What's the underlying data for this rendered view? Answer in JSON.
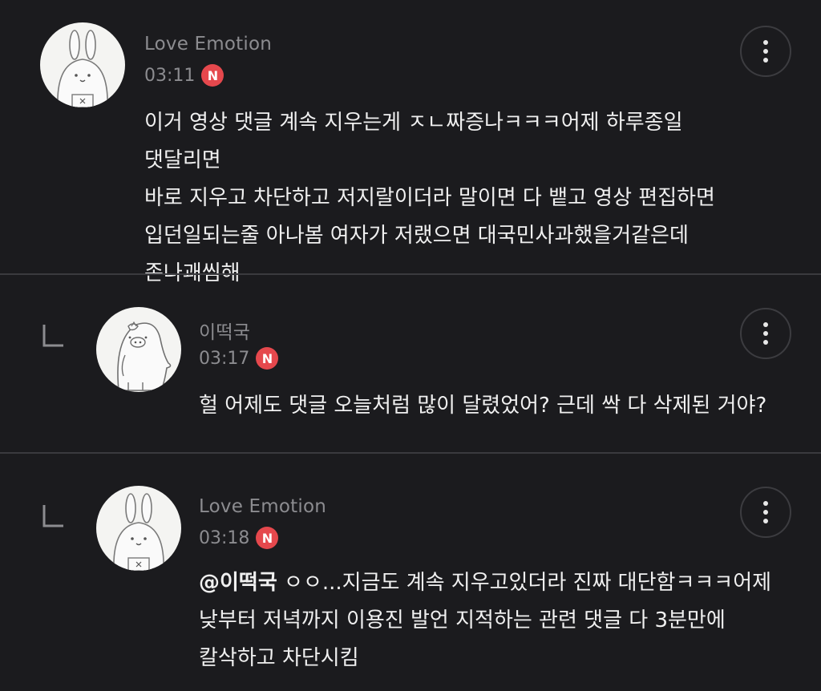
{
  "comments": [
    {
      "author": "Love Emotion",
      "time": "03:11",
      "badge": "N",
      "avatar": "rabbit-avatar",
      "text": "이거 영상 댓글 계속 지우는게 ㅈㄴ짜증나ㅋㅋㅋ어제 하루종일 댓달리면\n바로 지우고 차단하고 저지랄이더라 말이면 다 뱉고 영상 편집하면\n입던일되는줄 아나봄 여자가 저랬으면 대국민사과했을거같은데\n존나괘씸해"
    },
    {
      "author": "이떡국",
      "time": "03:17",
      "badge": "N",
      "avatar": "penguin-pig-avatar",
      "text": "헐 어제도 댓글 오늘처럼 많이 달렸었어? 근데 싹 다 삭제된 거야?"
    },
    {
      "author": "Love Emotion",
      "time": "03:18",
      "badge": "N",
      "avatar": "rabbit-avatar",
      "mention": "@이떡국",
      "text": "  ㅇㅇ...지금도 계속 지우고있더라 진짜 대단함ㅋㅋㅋ어제\n낮부터 저녁까지 이용진 발언 지적하는 관련 댓글 다 3분만에\n칼삭하고 차단시킴"
    }
  ],
  "more_icon": "more-vertical-icon",
  "reply_icon": "reply-corner-icon",
  "colors": {
    "background": "#1b1b1e",
    "badge": "#e5484d",
    "muted": "#8c8c90"
  }
}
